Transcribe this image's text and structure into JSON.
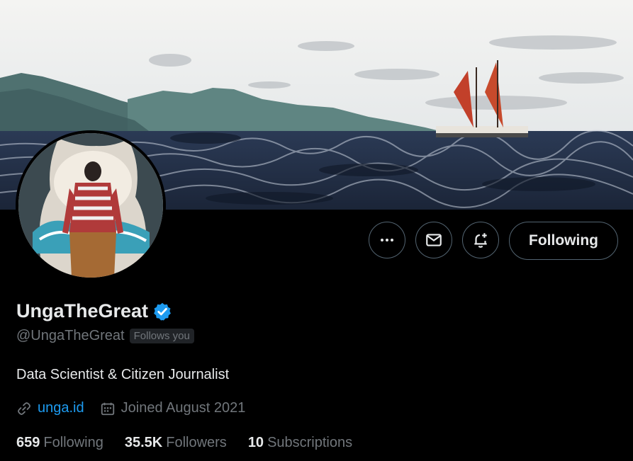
{
  "colors": {
    "background": "#000000",
    "primary_text": "#e7e9ea",
    "secondary_text": "#71767b",
    "link": "#1d9bf0",
    "verified": "#1d9bf0",
    "button_border": "#536471"
  },
  "header": {
    "banner_icon": "sailing-canoe-ocean-banner",
    "avatar_icon": "profile-avatar-man-flag-hoodie"
  },
  "actions": {
    "more_icon": "more-horizontal-icon",
    "message_icon": "envelope-icon",
    "notify_icon": "bell-plus-icon",
    "following_label": "Following"
  },
  "profile": {
    "display_name": "UngaTheGreat",
    "verified_icon": "verified-badge-icon",
    "handle": "@UngaTheGreat",
    "follows_you": "Follows you",
    "bio": "Data Scientist & Citizen Journalist",
    "website_icon": "link-icon",
    "website": "unga.id",
    "calendar_icon": "calendar-icon",
    "joined": "Joined August 2021"
  },
  "stats": [
    {
      "count": "659",
      "label": "Following"
    },
    {
      "count": "35.5K",
      "label": "Followers"
    },
    {
      "count": "10",
      "label": "Subscriptions"
    }
  ]
}
